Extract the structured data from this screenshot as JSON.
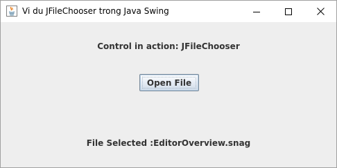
{
  "window": {
    "title": "Vi du JFileChooser trong Java Swing",
    "icon": "java-cup-icon",
    "controls": {
      "minimize_icon": "minimize-icon",
      "maximize_icon": "maximize-icon",
      "close_icon": "close-icon"
    }
  },
  "main": {
    "header_label": "Control in action: JFileChooser",
    "open_button_label": "Open File",
    "status_label": "File Selected :EditorOverview.snag"
  },
  "colors": {
    "content_background": "#eeeeee",
    "titlebar_background": "#ffffff",
    "text": "#333333"
  }
}
